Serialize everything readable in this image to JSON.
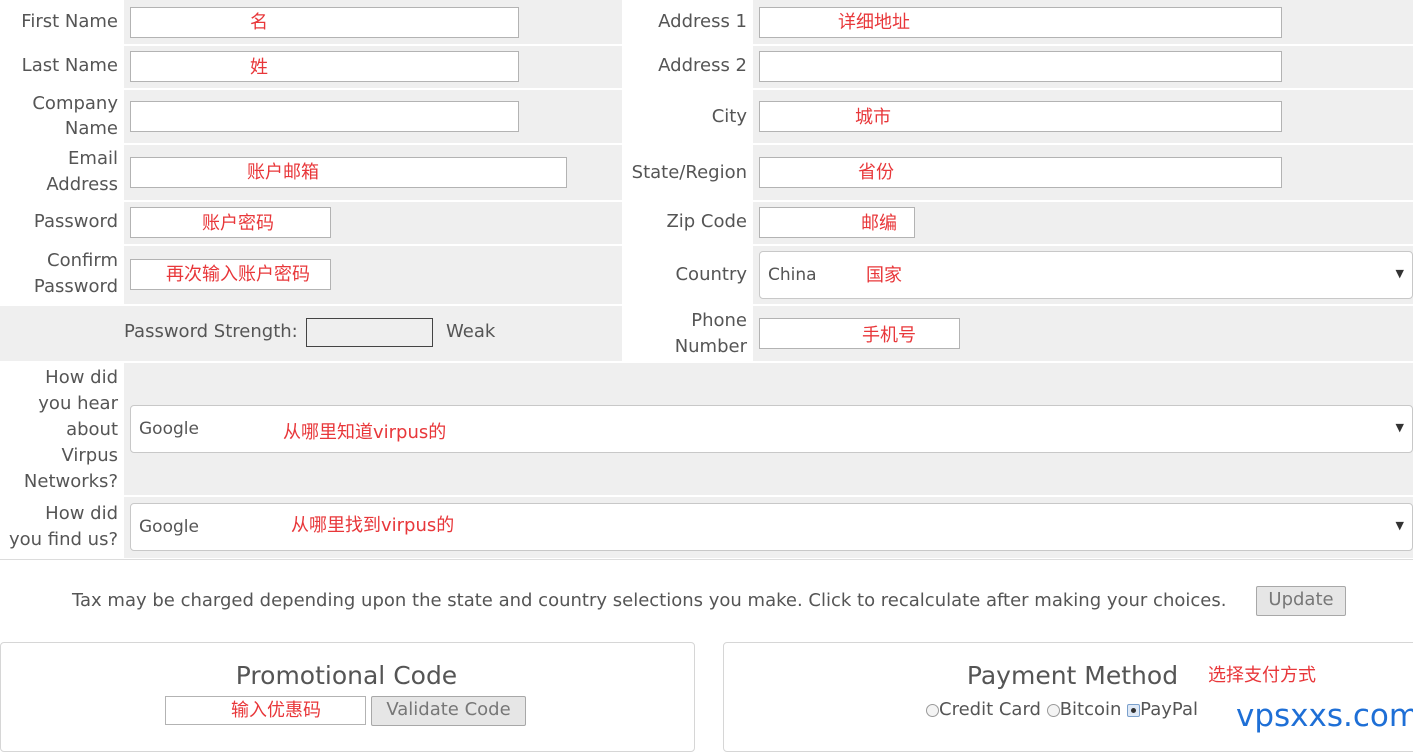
{
  "form": {
    "first_name_label": "First Name",
    "first_name_note": "名",
    "last_name_label": "Last Name",
    "last_name_note": "姓",
    "company_label_1": "Company",
    "company_label_2": "Name",
    "email_label_1": "Email",
    "email_label_2": "Address",
    "email_note": "账户邮箱",
    "password_label": "Password",
    "password_note": "账户密码",
    "confirm_label_1": "Confirm",
    "confirm_label_2": "Password",
    "confirm_note": "再次输入账户密码",
    "strength_label": "Password Strength:",
    "strength_value": "Weak",
    "address1_label": "Address 1",
    "address1_note": "详细地址",
    "address2_label": "Address 2",
    "city_label": "City",
    "city_note": "城市",
    "state_label": "State/Region",
    "state_note": "省份",
    "zip_label": "Zip Code",
    "zip_note": "邮编",
    "country_label": "Country",
    "country_value": "China",
    "country_note": "国家",
    "phone_label_1": "Phone",
    "phone_label_2": "Number",
    "phone_note": "手机号",
    "hear_label": [
      "How did",
      "you hear",
      "about",
      "Virpus",
      "Networks?"
    ],
    "hear_value": "Google",
    "hear_note": "从哪里知道virpus的",
    "find_label_1": "How did",
    "find_label_2": "you find us?",
    "find_value": "Google",
    "find_note": "从哪里找到virpus的"
  },
  "tax": {
    "text": "Tax may be charged depending upon the state and country selections you make. Click to recalculate after making your choices.",
    "button": "Update"
  },
  "promo": {
    "title": "Promotional Code",
    "note": "输入优惠码",
    "button": "Validate Code"
  },
  "payment": {
    "title": "Payment Method",
    "note": "选择支付方式",
    "options": [
      "Credit Card",
      "Bitcoin",
      "PayPal"
    ],
    "selected": "PayPal"
  },
  "watermark": "vpsxxs.com"
}
